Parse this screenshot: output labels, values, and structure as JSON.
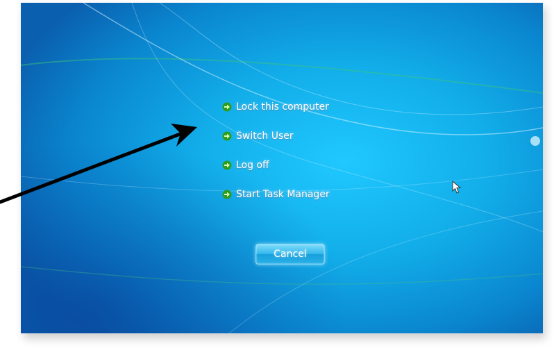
{
  "security_screen": {
    "options": [
      {
        "id": "lock",
        "label": "Lock this computer",
        "icon": "green-arrow-icon"
      },
      {
        "id": "switch-user",
        "label": "Switch User",
        "icon": "green-arrow-icon"
      },
      {
        "id": "log-off",
        "label": "Log off",
        "icon": "green-arrow-icon"
      },
      {
        "id": "task-manager",
        "label": "Start Task Manager",
        "icon": "green-arrow-icon"
      }
    ],
    "cancel_label": "Cancel"
  },
  "colors": {
    "background": "#12aeea",
    "option_text": "#ffffff",
    "option_arrow": "#4dbb2a",
    "annotation_arrow": "#000000"
  },
  "annotation": {
    "icon": "black-arrow-annotation",
    "points_to": "Switch User"
  },
  "pointer": {
    "icon": "mouse-cursor-icon"
  }
}
